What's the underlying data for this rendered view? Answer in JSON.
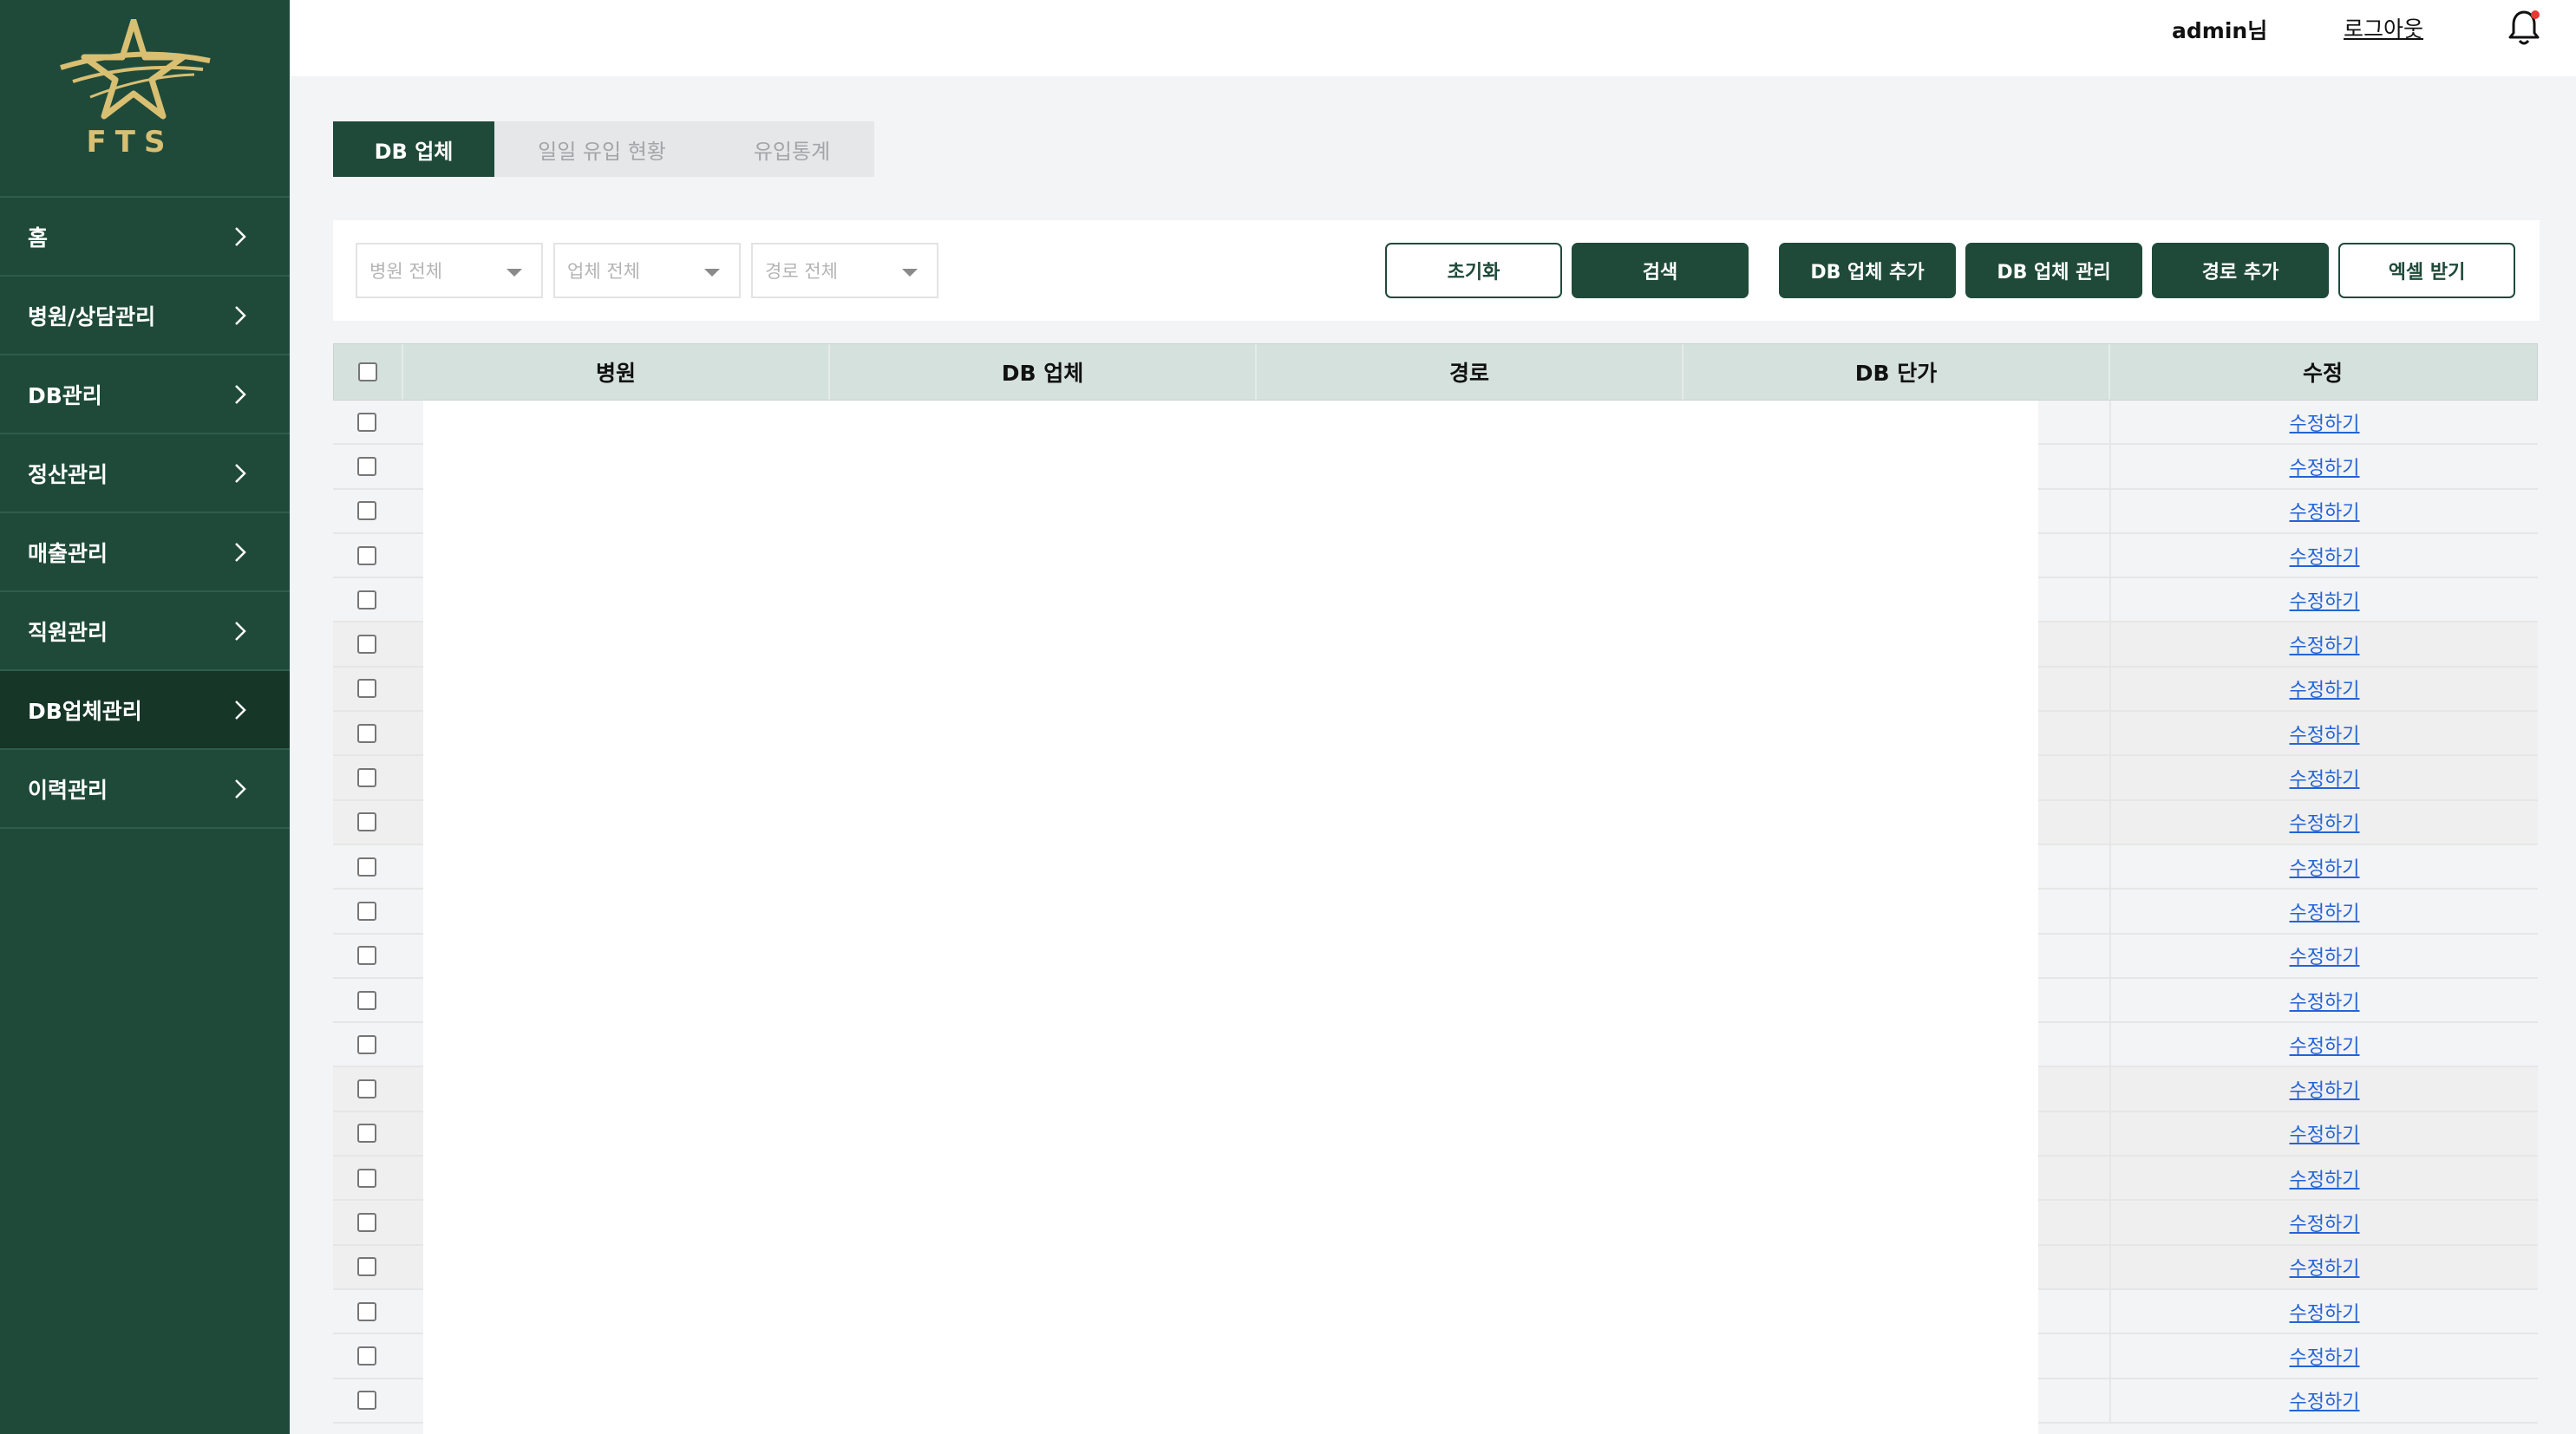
{
  "logo": {
    "text": "FTS"
  },
  "sidebar": {
    "items": [
      {
        "label": "홈",
        "active": false
      },
      {
        "label": "병원/상담관리",
        "active": false
      },
      {
        "label": "DB관리",
        "active": false
      },
      {
        "label": "정산관리",
        "active": false
      },
      {
        "label": "매출관리",
        "active": false
      },
      {
        "label": "직원관리",
        "active": false
      },
      {
        "label": "DB업체관리",
        "active": true
      },
      {
        "label": "이력관리",
        "active": false
      }
    ]
  },
  "header": {
    "user": "admin",
    "user_suffix": "님",
    "logout": "로그아웃",
    "has_notification": true
  },
  "tabs": [
    {
      "label": "DB 업체",
      "active": true
    },
    {
      "label": "일일 유입 현황",
      "active": false
    },
    {
      "label": "유입통계",
      "active": false
    }
  ],
  "filters": {
    "hospital": "병원 전체",
    "vendor": "업체 전체",
    "route": "경로 전체"
  },
  "buttons": {
    "reset": "초기화",
    "search": "검색",
    "add_vendor": "DB 업체 추가",
    "manage_vendor": "DB 업체 관리",
    "add_route": "경로 추가",
    "excel": "엑셀 받기"
  },
  "table": {
    "columns": [
      "병원",
      "DB 업체",
      "경로",
      "DB 단가",
      "수정"
    ],
    "edit_label": "수정하기",
    "row_count": 23
  },
  "colors": {
    "sidebar": "#1f4a3a",
    "sidebar_active": "#163628",
    "accent": "#1f4a3a",
    "header_row": "#d5e1dc",
    "link": "#2563d6",
    "logo_gold": "#d8bf72",
    "notification_dot": "#e53935"
  }
}
